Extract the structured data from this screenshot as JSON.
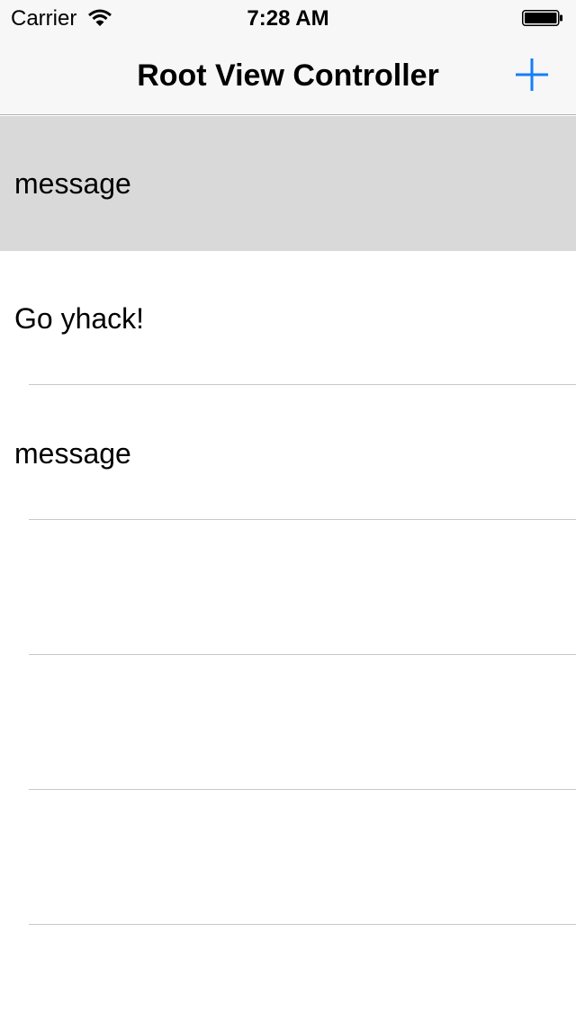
{
  "status_bar": {
    "carrier": "Carrier",
    "time": "7:28 AM",
    "wifi_icon": "wifi-icon",
    "battery_icon": "battery-icon"
  },
  "nav_bar": {
    "title": "Root View Controller",
    "add_icon": "plus-icon",
    "accent_color": "#147efb"
  },
  "table": {
    "selected_row_color": "#d9d9d9",
    "rows": [
      {
        "label": "message",
        "selected": true
      },
      {
        "label": "Go yhack!",
        "selected": false
      },
      {
        "label": "message",
        "selected": false
      },
      {
        "label": "",
        "selected": false
      },
      {
        "label": "",
        "selected": false
      },
      {
        "label": "",
        "selected": false
      },
      {
        "label": "",
        "selected": false
      }
    ]
  }
}
